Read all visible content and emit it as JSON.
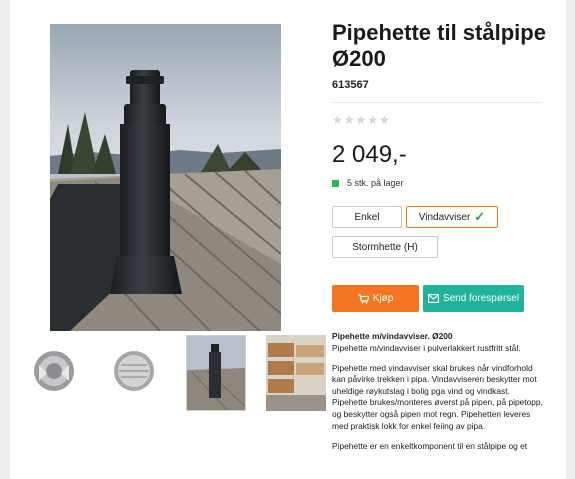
{
  "product": {
    "title": "Pipehette til stålpipe Ø200",
    "sku": "613567",
    "rating_stars": "★★★★★",
    "price": "2 049,-",
    "stock": "5 stk. på lager"
  },
  "variants": [
    {
      "label": "Enkel",
      "selected": false
    },
    {
      "label": "Vindavviser",
      "selected": true
    },
    {
      "label": "Stormhette (H)",
      "selected": false
    }
  ],
  "actions": {
    "buy_label": "Kjøp",
    "request_label": "Send forespørsel"
  },
  "description": {
    "heading": "Pipehette m/vindavviser. Ø200",
    "subheading": "Pipehette m/vindavviser i pulverlakkert rustfritt stål.",
    "paragraph1": "Pipehette med vindavviser skal brukes når vindforhold kan påvirke trekken i pipa. Vindavviseren beskytter mot uheldige røykutslag i bolig pga vind og vindkast. Pipehette brukes/monteres øverst på pipen, på pipetopp, og beskytter også pipen mot regn. Pipehetten leveres med praktisk lokk for enkel feiing av pipa.",
    "paragraph2": "Pipehette er en enkeltkomponent til en stålpipe og et"
  },
  "colors": {
    "accent_orange": "#f37521",
    "teal": "#1fb39b",
    "in_stock_green": "#2eb84b",
    "check_green": "#2ca44a"
  },
  "icons": [
    "cart-icon",
    "envelope-icon",
    "check-icon"
  ]
}
